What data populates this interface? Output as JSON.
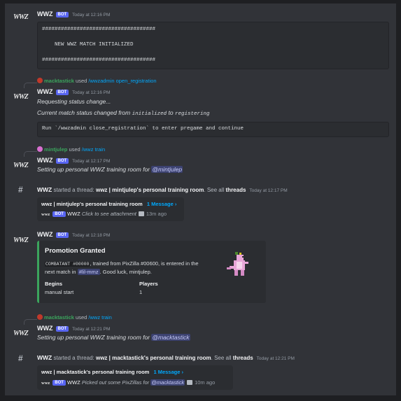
{
  "bot_name": "WWZ",
  "bot_tag": "BOT",
  "avatar_text": "WWZ",
  "messages": {
    "m1": {
      "time": "Today at 12:16 PM",
      "code": "####################################\n\n    NEW WWZ MATCH INITIALIZED\n\n####################################"
    },
    "m2": {
      "user": "macktastick",
      "used": "used",
      "command": "/wwzadmin open_registration",
      "time": "Today at 12:16 PM",
      "line1": "Requesting status change...",
      "line2_pre": "Current match status changed from",
      "line2_from": "initialized",
      "line2_mid": "to",
      "line2_to": "registering",
      "code": "Run `/wwzadmin close_registration` to enter pregame and continue"
    },
    "m3": {
      "user": "mintjulep",
      "used": "used",
      "command": "/wwz train",
      "time": "Today at 12:17 PM",
      "text": "Setting up personal WWZ training room for",
      "mention": "@mintjulep"
    },
    "t1": {
      "started": "started a thread:",
      "thread_name": "wwz | mintjulep's personal training room",
      "see_all": ". See all",
      "threads": "threads",
      "time": "Today at 12:17 PM",
      "card_title": "wwz | mintjulep's personal training room",
      "card_count": "1 Message ›",
      "preview_avatar": "wwz",
      "preview_text": "Click to see attachment",
      "preview_time": "13m ago"
    },
    "m4": {
      "time": "Today at 12:18 PM",
      "embed_title": "Promotion Granted",
      "embed_code": "COMBATANT #00000",
      "embed_text1": ", trained from PixZilla #00600, is entered in the",
      "embed_text2a": "next match in",
      "embed_channel": "#lil-mmz",
      "embed_text2b": ". Good luck, mintjulep.",
      "field1_name": "Begins",
      "field1_value": "manual start",
      "field2_name": "Players",
      "field2_value": "1"
    },
    "m5": {
      "user": "macktastick",
      "used": "used",
      "command": "/wwz train",
      "time": "Today at 12:21 PM",
      "text": "Setting up personal WWZ training room for",
      "mention": "@macktastick"
    },
    "t2": {
      "started": "started a thread:",
      "thread_name": "wwz | macktastick's personal training room",
      "see_all": ". See all",
      "threads": "threads",
      "time": "Today at 12:21 PM",
      "card_title": "wwz | macktastick's personal training room",
      "card_count": "1 Message ›",
      "preview_avatar": "wwz",
      "preview_text": "Picked out some PixZillas for",
      "preview_mention": "@macktastick",
      "preview_time": "10m ago"
    }
  },
  "colors": {
    "background": "#313338",
    "outer": "#1e1f22",
    "bot_badge": "#5865f2",
    "embed_accent": "#3ba55d",
    "link": "#00a8fc"
  }
}
